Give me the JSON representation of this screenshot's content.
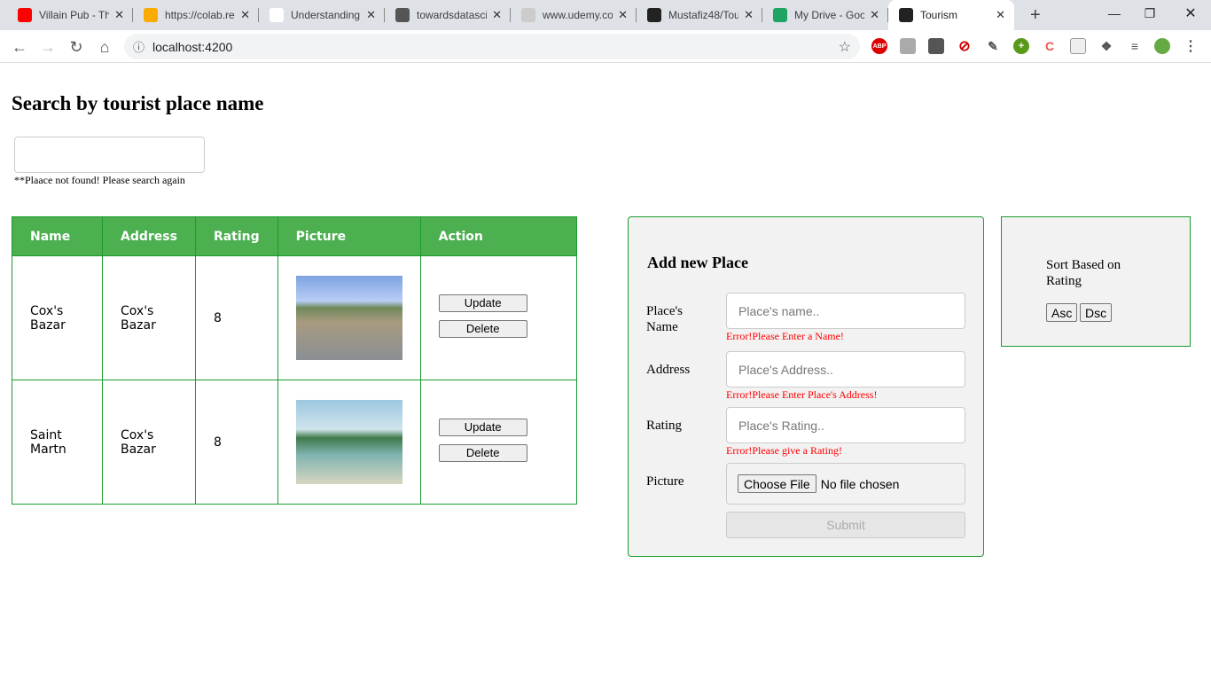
{
  "browser": {
    "tabs": [
      {
        "title": "Villain Pub - Th",
        "icon": "youtube-icon",
        "color": "#f00"
      },
      {
        "title": "https://colab.re",
        "icon": "colab-icon",
        "color": "#f9ab00"
      },
      {
        "title": "Understanding",
        "icon": "chart-icon",
        "color": "#fff"
      },
      {
        "title": "towardsdatasci",
        "icon": "tds-icon",
        "color": "#555"
      },
      {
        "title": "www.udemy.co",
        "icon": "udemy-icon",
        "color": "#ccc"
      },
      {
        "title": "Mustafiz48/Tou",
        "icon": "github-icon",
        "color": "#222"
      },
      {
        "title": "My Drive - Goo",
        "icon": "drive-icon",
        "color": "#1fa463"
      },
      {
        "title": "Tourism",
        "icon": "angular-icon",
        "color": "#222"
      }
    ],
    "url": "localhost:4200"
  },
  "page": {
    "title": "Search by tourist place name",
    "search_value": "",
    "not_found": "**Plaace not found! Please search again"
  },
  "table": {
    "headers": [
      "Name",
      "Address",
      "Rating",
      "Picture",
      "Action"
    ],
    "rows": [
      {
        "name": "Cox's Bazar",
        "address": "Cox's Bazar",
        "rating": "8"
      },
      {
        "name": "Saint Martn",
        "address": "Cox's Bazar",
        "rating": "8"
      }
    ],
    "update_label": "Update",
    "delete_label": "Delete"
  },
  "form": {
    "title": "Add new Place",
    "name_label": "Place's Name",
    "name_placeholder": "Place's name..",
    "name_error": "Error!Please Enter a Name!",
    "address_label": "Address",
    "address_placeholder": "Place's Address..",
    "address_error": "Error!Please Enter Place's Address!",
    "rating_label": "Rating",
    "rating_placeholder": "Place's Rating..",
    "rating_error": "Error!Please give a Rating!",
    "picture_label": "Picture",
    "choose_file": "Choose File",
    "no_file": "No file chosen",
    "submit": "Submit"
  },
  "sort": {
    "title": "Sort Based on Rating",
    "asc": "Asc",
    "dsc": "Dsc"
  }
}
